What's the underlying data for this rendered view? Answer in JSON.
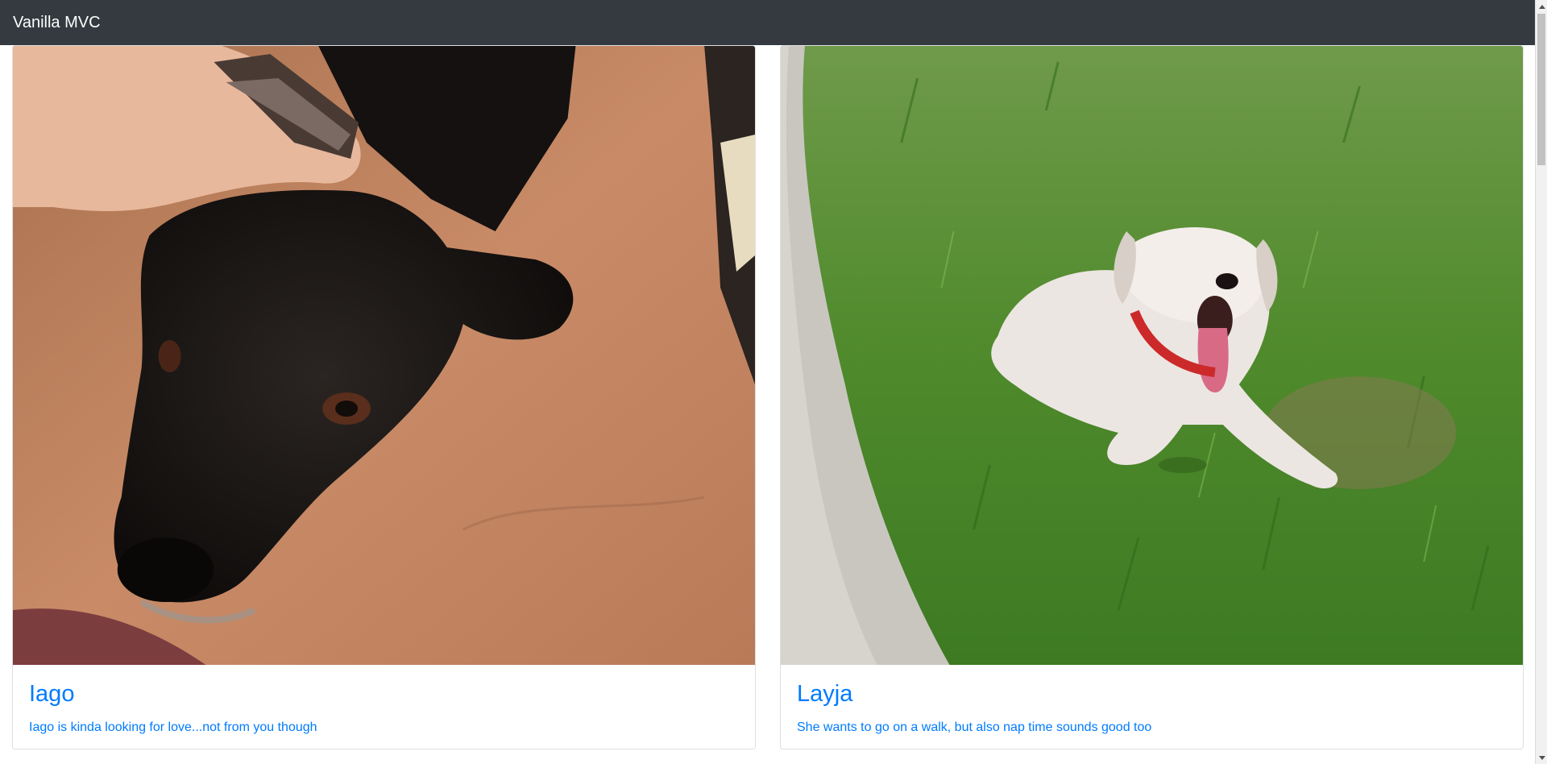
{
  "navbar": {
    "brand": "Vanilla MVC"
  },
  "cards": [
    {
      "name": "Iago",
      "description": "Iago is kinda looking for love...not from you though",
      "image_subject": "black-dog-resting-on-lap-photo"
    },
    {
      "name": "Layja",
      "description": "She wants to go on a walk, but also nap time sounds good too",
      "image_subject": "white-dog-yawning-on-grass-photo"
    }
  ],
  "colors": {
    "navbar_bg": "#343a40",
    "link": "#007bff"
  }
}
